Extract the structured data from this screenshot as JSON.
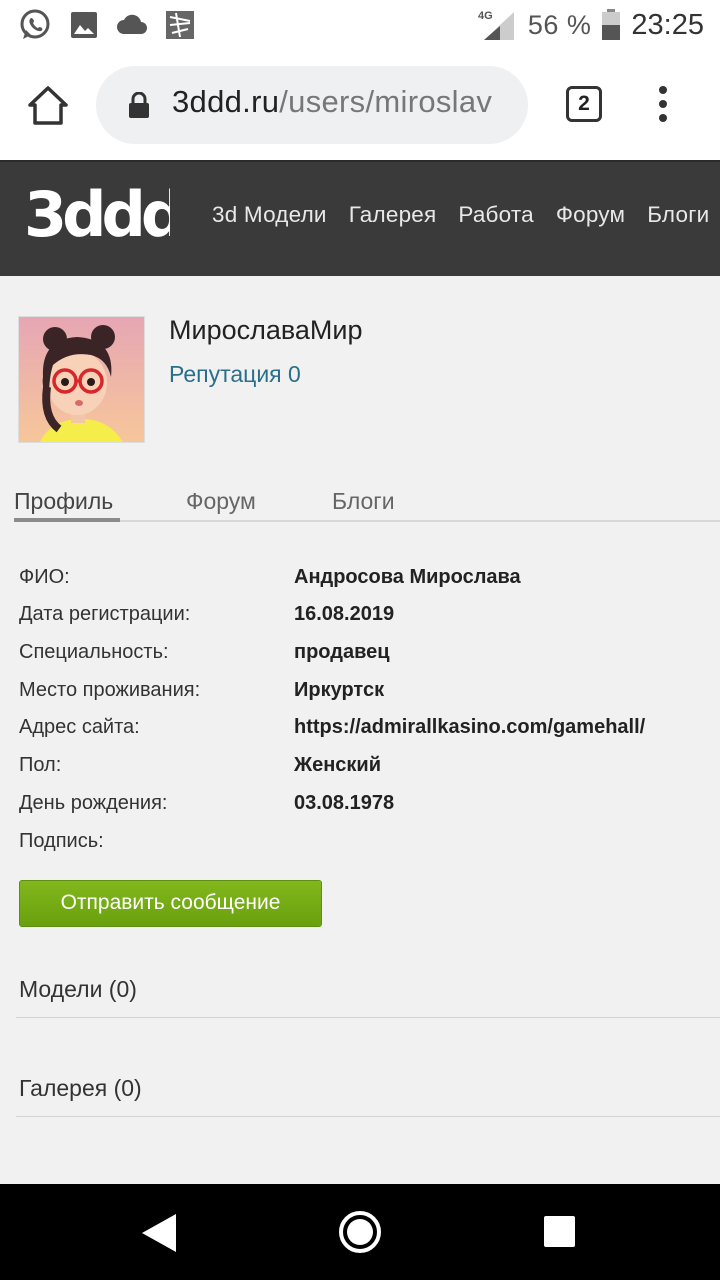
{
  "status_bar": {
    "network": "4G",
    "battery": "56 %",
    "time": "23:25",
    "icons": [
      "whatsapp-icon",
      "gallery-icon",
      "cloud-icon",
      "app-icon",
      "signal-icon",
      "battery-icon"
    ]
  },
  "browser": {
    "url_domain": "3ddd.ru",
    "url_path": "/users/miroslav",
    "tab_count": "2"
  },
  "site": {
    "logo": "3ddd",
    "nav": [
      "3d Модели",
      "Галерея",
      "Работа",
      "Форум",
      "Блоги"
    ]
  },
  "profile": {
    "username": "МирославаМир",
    "reputation": "Репутация 0"
  },
  "tabs": [
    "Профиль",
    "Форум",
    "Блоги"
  ],
  "info": [
    {
      "label": "ФИО:",
      "value": "Андросова Мирослава"
    },
    {
      "label": "Дата регистрации:",
      "value": "16.08.2019"
    },
    {
      "label": "Специальность:",
      "value": "продавец"
    },
    {
      "label": "Место проживания:",
      "value": "Иркуртск"
    },
    {
      "label": "Адрес сайта:",
      "value": "https://admirallkasino.com/gamehall/"
    },
    {
      "label": "Пол:",
      "value": "Женский"
    },
    {
      "label": "День рождения:",
      "value": "03.08.1978"
    },
    {
      "label": "Подпись:",
      "value": ""
    }
  ],
  "send_message_label": "Отправить сообщение",
  "sections": {
    "models": "Модели (0)",
    "gallery": "Галерея (0)"
  },
  "colors": {
    "header_bg": "#3a3a3a",
    "link": "#2a6f8a",
    "button_green": "#74aa12"
  }
}
